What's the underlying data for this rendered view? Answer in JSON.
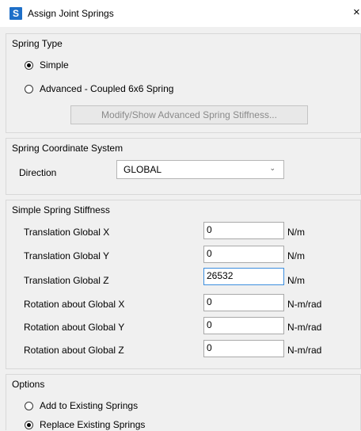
{
  "window": {
    "title": "Assign Joint Springs",
    "app_icon_letter": "S",
    "close_glyph": "×",
    "accent": "#1e6fc8"
  },
  "spring_type": {
    "label": "Spring Type",
    "options": [
      {
        "label": "Simple",
        "checked": true
      },
      {
        "label": "Advanced - Coupled 6x6 Spring",
        "checked": false
      }
    ],
    "advanced_button": "Modify/Show Advanced Spring Stiffness..."
  },
  "coord_system": {
    "label": "Spring Coordinate System",
    "direction_label": "Direction",
    "direction_value": "GLOBAL"
  },
  "stiffness": {
    "label": "Simple Spring Stiffness",
    "rows": [
      {
        "label": "Translation Global X",
        "value": "0",
        "unit": "N/m"
      },
      {
        "label": "Translation Global Y",
        "value": "0",
        "unit": "N/m"
      },
      {
        "label": "Translation Global Z",
        "value": "26532",
        "unit": "N/m"
      },
      {
        "label": "Rotation about Global X",
        "value": "0",
        "unit": "N-m/rad"
      },
      {
        "label": "Rotation about Global Y",
        "value": "0",
        "unit": "N-m/rad"
      },
      {
        "label": "Rotation about Global Z",
        "value": "0",
        "unit": "N-m/rad"
      }
    ]
  },
  "options": {
    "label": "Options",
    "items": [
      {
        "label": "Add to Existing Springs",
        "checked": false
      },
      {
        "label": "Replace Existing Springs",
        "checked": true
      }
    ]
  }
}
